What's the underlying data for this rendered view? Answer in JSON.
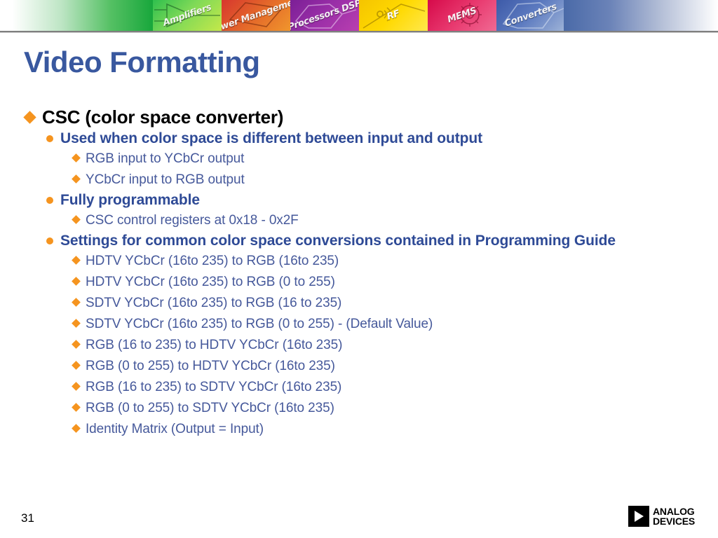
{
  "banner": {
    "panels": [
      {
        "label": "Amplifiers",
        "color": "#2fbf4e",
        "class": "p-amplifiers"
      },
      {
        "label": "Power Management",
        "color": "#e4682a",
        "class": "p-power"
      },
      {
        "label": "Processors DSP",
        "color": "#9b2fa8",
        "class": "p-processors"
      },
      {
        "label": "RF",
        "color": "#ffd900",
        "class": "p-rf"
      },
      {
        "label": "MEMS",
        "color": "#e8386e",
        "class": "p-mems"
      },
      {
        "label": "Converters",
        "color": "#5d7bc0",
        "class": "p-converters"
      }
    ]
  },
  "title": "Video Formatting",
  "content": {
    "l1_csc": "CSC (color space converter)",
    "l2_used_when": "Used when color space is different between input and output",
    "l3_rgb_to_ycbcr": "RGB input to YCbCr output",
    "l3_ycbcr_to_rgb": "YCbCr input to RGB output",
    "l2_fully_programmable": "Fully programmable",
    "l3_csc_registers": "CSC control registers at 0x18 - 0x2F",
    "l2_settings": "Settings for common color space conversions contained in Programming Guide",
    "conversions": [
      "HDTV YCbCr  (16to 235)  to RGB (16to 235)",
      "HDTV YCbCr  (16to 235) to RGB (0 to 255)",
      "SDTV YCbCr  (16to 235) to RGB (16 to 235)",
      "SDTV YCbCr  (16to 235)  to RGB (0 to 255) -  (Default Value)",
      "RGB (16 to 235) to HDTV YCbCr  (16to 235)",
      "RGB (0 to 255) to HDTV YCbCr  (16to 235)",
      "RGB (16 to 235) to SDTV YCbCr  (16to 235)",
      "RGB (0 to 255) to SDTV YCbCr  (16to 235)",
      "Identity Matrix (Output = Input)"
    ]
  },
  "footer": {
    "page_number": "31",
    "logo_line1": "ANALOG",
    "logo_line2": "DEVICES"
  },
  "colors": {
    "title_blue": "#39589f",
    "bullet_orange": "#F5941F",
    "level2_blue": "#2E4A96",
    "level3_blue": "#46599B"
  }
}
